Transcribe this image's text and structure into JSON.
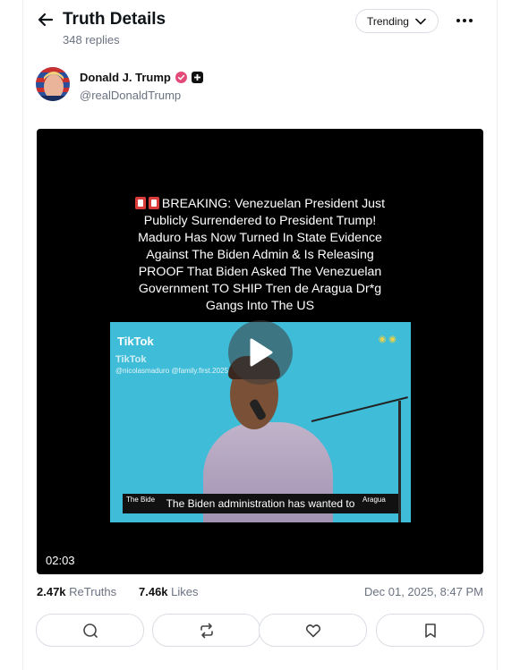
{
  "header": {
    "title": "Truth Details",
    "reply_count": "348 replies",
    "feed_selector": "Trending"
  },
  "author": {
    "name": "Donald J. Trump",
    "handle": "@realDonaldTrump",
    "verified_color": "#e24a7a"
  },
  "video": {
    "overlay_text_lines": [
      "BREAKING: Venezuelan President Just",
      "Publicly Surrendered to President Trump!",
      "Maduro Has Now Turned In State Evidence",
      "Against The Biden Admin & Is Releasing",
      "PROOF That Biden Asked The Venezuelan",
      "Government TO SHIP Tren de Aragua Dr*g",
      "Gangs Into The US"
    ],
    "tiktok_label": "TikTok",
    "tiktok_label_2": "TikTok",
    "tiktok_handles": "@nicolasmaduro @family.first.2025",
    "caption": "The Biden administration has wanted to",
    "caption_left": "The Bide",
    "caption_right": "Aragua",
    "duration": "02:03"
  },
  "stats": {
    "retruths_count": "2.47k",
    "retruths_label": "ReTruths",
    "likes_count": "7.46k",
    "likes_label": "Likes",
    "timestamp": "Dec 01, 2025, 8:47 PM"
  },
  "actions": {
    "icons": [
      "reply-icon",
      "retruth-icon",
      "like-icon",
      "bookmark-icon"
    ]
  },
  "colors": {
    "text": "#0f1419",
    "muted": "#6b7280",
    "border": "#d9dde3"
  }
}
